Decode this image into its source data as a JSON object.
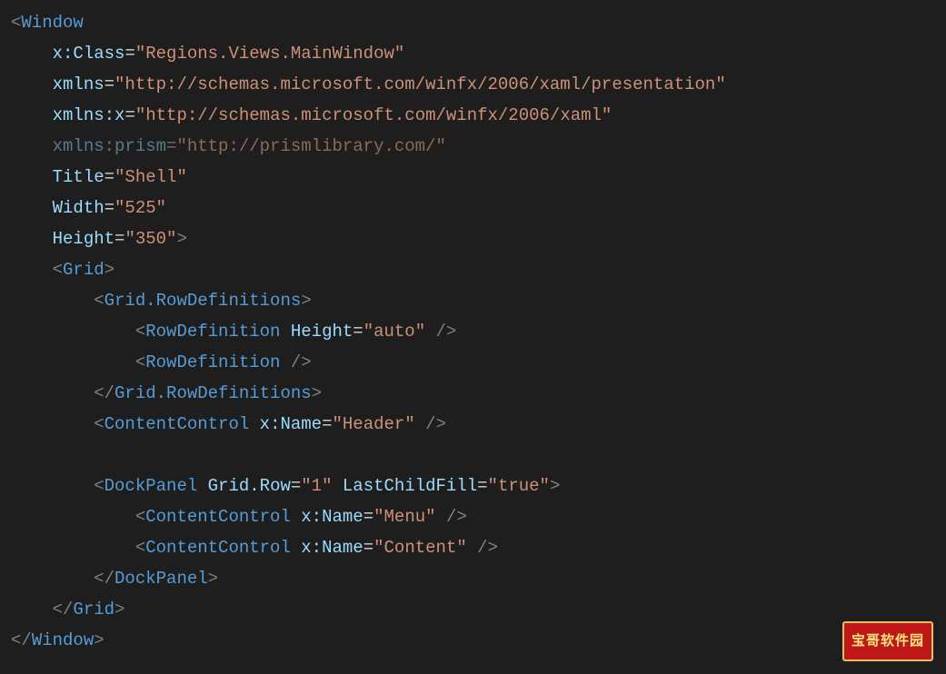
{
  "code": {
    "tags": {
      "Window": "Window",
      "Grid": "Grid",
      "GridRowDefs": "Grid.RowDefinitions",
      "RowDefinition": "RowDefinition",
      "ContentControl": "ContentControl",
      "DockPanel": "DockPanel"
    },
    "attrs": {
      "xClass": "x:Class",
      "xmlns": "xmlns",
      "xmlnsX": "xmlns:x",
      "xmlnsPrism": "xmlns:prism",
      "Title": "Title",
      "Width": "Width",
      "Height": "Height",
      "RowHeight": "Height",
      "xName": "x:Name",
      "GridRow": "Grid.Row",
      "LastChildFill": "LastChildFill"
    },
    "values": {
      "xClass": "\"Regions.Views.MainWindow\"",
      "xmlns": "\"http://schemas.microsoft.com/winfx/2006/xaml/presentation\"",
      "xmlnsX": "\"http://schemas.microsoft.com/winfx/2006/xaml\"",
      "xmlnsPrism": "\"http://prismlibrary.com/\"",
      "Title": "\"Shell\"",
      "Width": "\"525\"",
      "Height": "\"350\"",
      "RowHeightAuto": "\"auto\"",
      "HeaderName": "\"Header\"",
      "GridRow1": "\"1\"",
      "LastChildFillTrue": "\"true\"",
      "MenuName": "\"Menu\"",
      "ContentName": "\"Content\""
    }
  },
  "watermark": "宝哥软件园"
}
